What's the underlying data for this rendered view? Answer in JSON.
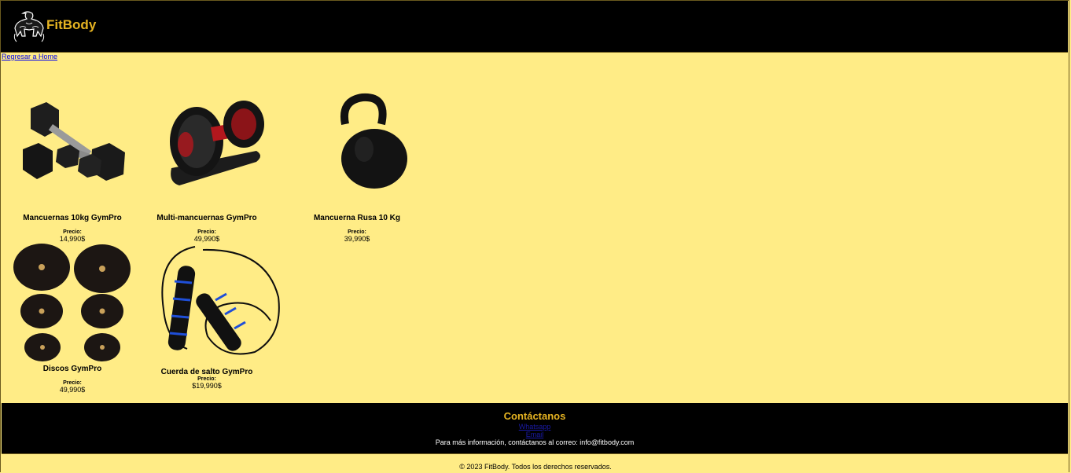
{
  "header": {
    "brand": "FitBody",
    "logo_icon": "bodybuilder-logo-icon"
  },
  "nav": {
    "back_link": "Regresar a Home"
  },
  "products": [
    {
      "name": "Mancuernas 10kg GymPro",
      "price_label": "Precio:",
      "price": "14,990$",
      "image": "dumbbells-image"
    },
    {
      "name": "Multi-mancuernas GymPro",
      "price_label": "Precio:",
      "price": "49,990$",
      "image": "adjustable-dumbbell-image"
    },
    {
      "name": "Mancuerna Rusa 10 Kg",
      "price_label": "Precio:",
      "price": "39,990$",
      "image": "kettlebell-image"
    },
    {
      "name": "Discos GymPro",
      "price_label": "Precio:",
      "price": "49,990$",
      "image": "weight-plates-image"
    },
    {
      "name": "Cuerda de salto GymPro",
      "price_label": "Precio:",
      "price": "$19,990$",
      "image": "jump-rope-image"
    }
  ],
  "footer": {
    "title": "Contáctanos",
    "links": [
      "Whatsapp",
      "Email"
    ],
    "info": "Para más información, contáctanos al correo: info@fitbody.com",
    "copyright": "© 2023 FitBody. Todos los derechos reservados."
  },
  "colors": {
    "background": "#ffec86",
    "header_bg": "#000000",
    "accent": "#e6b422"
  }
}
